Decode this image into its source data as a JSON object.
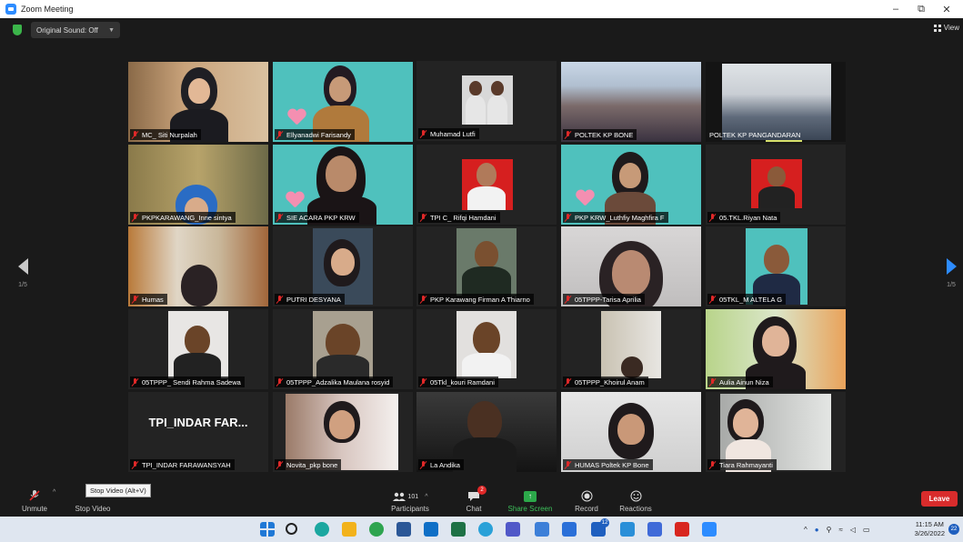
{
  "window": {
    "title": "Zoom Meeting",
    "min": "–",
    "max": "⧉",
    "close": "✕"
  },
  "top": {
    "original_sound": "Original Sound: Off",
    "view": "View"
  },
  "pagination": {
    "left": "1/5",
    "right": "1/5"
  },
  "participants": [
    {
      "name": "MC_ Siti Nurpalah"
    },
    {
      "name": "Ellyanadwi Farisandy"
    },
    {
      "name": "Muhamad Lutfi"
    },
    {
      "name": "POLTEK KP BONE"
    },
    {
      "name": "POLTEK KP PANGANDARAN"
    },
    {
      "name": "PKPKARAWANG_Inne sintya"
    },
    {
      "name": "SIE ACARA PKP KRW"
    },
    {
      "name": "TPI C_ Rifqi Hamdani"
    },
    {
      "name": "PKP KRW_Luthfiy Maghfira F"
    },
    {
      "name": "05.TKL.Riyan Nata"
    },
    {
      "name": "Humas"
    },
    {
      "name": "PUTRI DESYANA"
    },
    {
      "name": "PKP Karawang Firman A Thiarno"
    },
    {
      "name": "05TPPP-Tarisa Aprilia"
    },
    {
      "name": "05TKL_M ALTELA G"
    },
    {
      "name": "05TPPP_ Sendi Rahma Sadewa"
    },
    {
      "name": "05TPPP_Adzalika Maulana rosyid"
    },
    {
      "name": "05Tkl_kouri Ramdani"
    },
    {
      "name": "05TPPP_Khoirul Anam"
    },
    {
      "name": "Aulia Ainun Niza"
    },
    {
      "name": "TPI_INDAR FARAWANSYAH",
      "display": "TPI_INDAR FAR..."
    },
    {
      "name": "Novita_pkp bone"
    },
    {
      "name": "La Andika"
    },
    {
      "name": "HUMAS Poltek KP Bone"
    },
    {
      "name": "Tiara Rahmayanti"
    }
  ],
  "toolbar": {
    "unmute": "Unmute",
    "stop_video": "Stop Video",
    "tooltip": "Stop Video (Alt+V)",
    "participants": "Participants",
    "participants_count": "101",
    "chat": "Chat",
    "chat_badge": "2",
    "share": "Share Screen",
    "record": "Record",
    "reactions": "Reactions",
    "leave": "Leave"
  },
  "taskbar": {
    "time": "11:15 AM",
    "date": "3/26/2022",
    "notifications": "22",
    "teams_badge": "12"
  }
}
